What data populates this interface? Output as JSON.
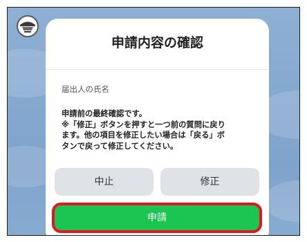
{
  "dialog": {
    "title": "申請内容の確認",
    "field_label": "届出人の氏名",
    "message_lines": [
      "申請前の最終確認です。",
      "※「修正」ボタンを押すと一つ前の質問に戻り",
      "ます。他の項目を修正したい場合は「戻る」ボ",
      "タンで戻って修正してください。"
    ]
  },
  "buttons": {
    "cancel_label": "中止",
    "edit_label": "修正",
    "apply_label": "申請"
  },
  "colors": {
    "background": "#86a9d0",
    "apply_button": "#1bc552",
    "highlight_border": "#e5141e",
    "secondary_button": "#dfe3e8"
  },
  "icons": {
    "logo": "municipal-emblem-icon"
  }
}
